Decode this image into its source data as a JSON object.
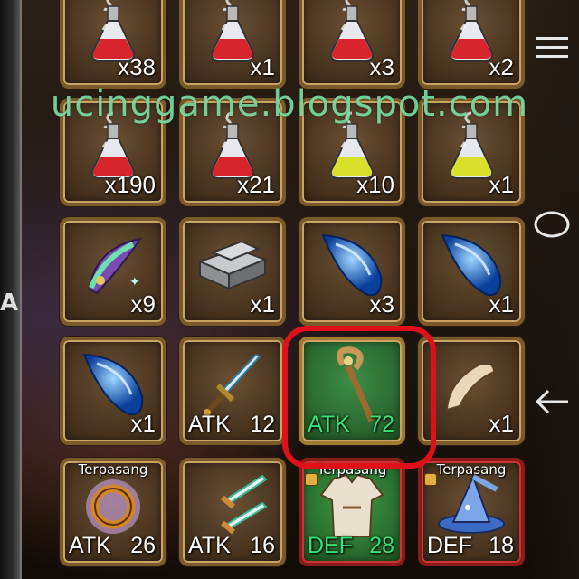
{
  "watermark": "ucinggame.blogspot.com",
  "left_edge_char": "A",
  "nav": [
    {
      "name": "menu",
      "icon": "hamburger-menu-icon"
    },
    {
      "name": "home",
      "icon": "circle-home-icon"
    },
    {
      "name": "back",
      "icon": "back-arrow-icon"
    }
  ],
  "grid": [
    [
      {
        "icon": "red-potion-icon",
        "count": "x38"
      },
      {
        "icon": "red-potion-icon",
        "count": "x1"
      },
      {
        "icon": "red-potion-icon",
        "count": "x3"
      },
      {
        "icon": "red-potion-icon",
        "count": "x2"
      }
    ],
    [
      {
        "icon": "red-potion-icon",
        "count": "x190"
      },
      {
        "icon": "red-potion-icon",
        "count": "x21"
      },
      {
        "icon": "yellow-potion-icon",
        "count": "x10"
      },
      {
        "icon": "yellow-potion-icon",
        "count": "x1"
      }
    ],
    [
      {
        "icon": "feather-gem-icon",
        "count": "x9"
      },
      {
        "icon": "iron-ingot-icon",
        "count": "x1"
      },
      {
        "icon": "blue-crystal-icon",
        "count": "x3"
      },
      {
        "icon": "blue-crystal-icon",
        "count": "x1"
      }
    ],
    [
      {
        "icon": "blue-crystal-icon",
        "count": "x1"
      },
      {
        "icon": "sword-icon",
        "stat": "ATK",
        "value": "12"
      },
      {
        "icon": "staff-icon",
        "stat": "ATK",
        "value": "72",
        "selected": true
      },
      {
        "icon": "horn-icon",
        "count": "x1"
      }
    ],
    [
      {
        "icon": "ring-icon",
        "stat": "ATK",
        "value": "26",
        "tag": "Terpasang"
      },
      {
        "icon": "daggers-icon",
        "stat": "ATK",
        "value": "16"
      },
      {
        "icon": "tunic-icon",
        "stat": "DEF",
        "value": "28",
        "tag": "Terpasang",
        "locked": true,
        "equip": "green"
      },
      {
        "icon": "wizard-hat-icon",
        "stat": "DEF",
        "value": "18",
        "tag": "Terpasang",
        "locked": true,
        "equip": "red"
      }
    ]
  ],
  "colors": {
    "accent_green": "#38e07a",
    "highlight_red": "#e0101a",
    "frame_gold": "#c9a462"
  }
}
